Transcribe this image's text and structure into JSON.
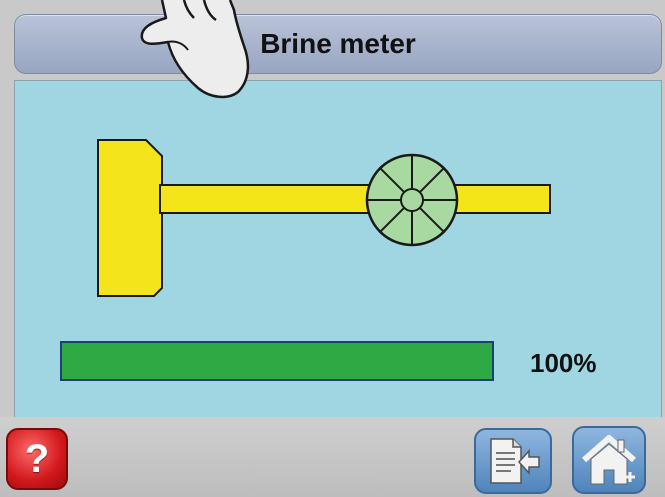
{
  "header": {
    "title": "Brine meter"
  },
  "progress": {
    "value_percent": 100,
    "label": "100%"
  },
  "toolbar": {
    "help_icon": "question-mark-icon",
    "back_icon": "document-back-icon",
    "home_icon": "home-icon"
  },
  "colors": {
    "panel_background": "#9fd6e1",
    "pipe_yellow": "#f4e51a",
    "wheel_green": "#a8d9a0",
    "progress_green": "#2ea944",
    "help_red": "#d1181c",
    "nav_blue": "#5b8fc4"
  }
}
